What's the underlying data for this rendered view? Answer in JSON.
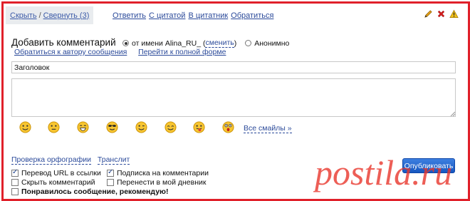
{
  "toolbar": {
    "hide": "Скрыть",
    "collapse": "Свернуть (3)",
    "actions": [
      "Ответить",
      "С цитатой",
      "В цитатник",
      "Обратиться"
    ]
  },
  "form": {
    "title": "Добавить комментарий",
    "as_user_prefix": "от имени Alina_RU_",
    "change": "сменить",
    "anonymous": "Анонимно",
    "address_author": "Обратиться к автору сообщения",
    "full_form": "Перейти к полной форме",
    "subject_value": "Заголовок",
    "all_smilies": "Все смайлы »"
  },
  "tools": {
    "spellcheck": "Проверка орфографии",
    "translit": "Транслит"
  },
  "options": [
    {
      "label": "Перевод URL в ссылки",
      "checked": true
    },
    {
      "label": "Подписка на комментарии",
      "checked": true
    },
    {
      "label": "Скрыть комментарий",
      "checked": false
    },
    {
      "label": "Перенести в мой дневник",
      "checked": false
    },
    {
      "label": "Понравилось сообщение, рекомендую!",
      "checked": false
    }
  ],
  "publish": "Опубликовать",
  "watermark": "postila.ru",
  "colors": {
    "frame": "#e0202a",
    "link": "#2b4a9a",
    "publish": "#1657c0",
    "watermark": "#e8362c"
  },
  "smilies": [
    "smile",
    "neutral",
    "grin",
    "cool",
    "wink",
    "happy",
    "tongue",
    "surprised"
  ]
}
